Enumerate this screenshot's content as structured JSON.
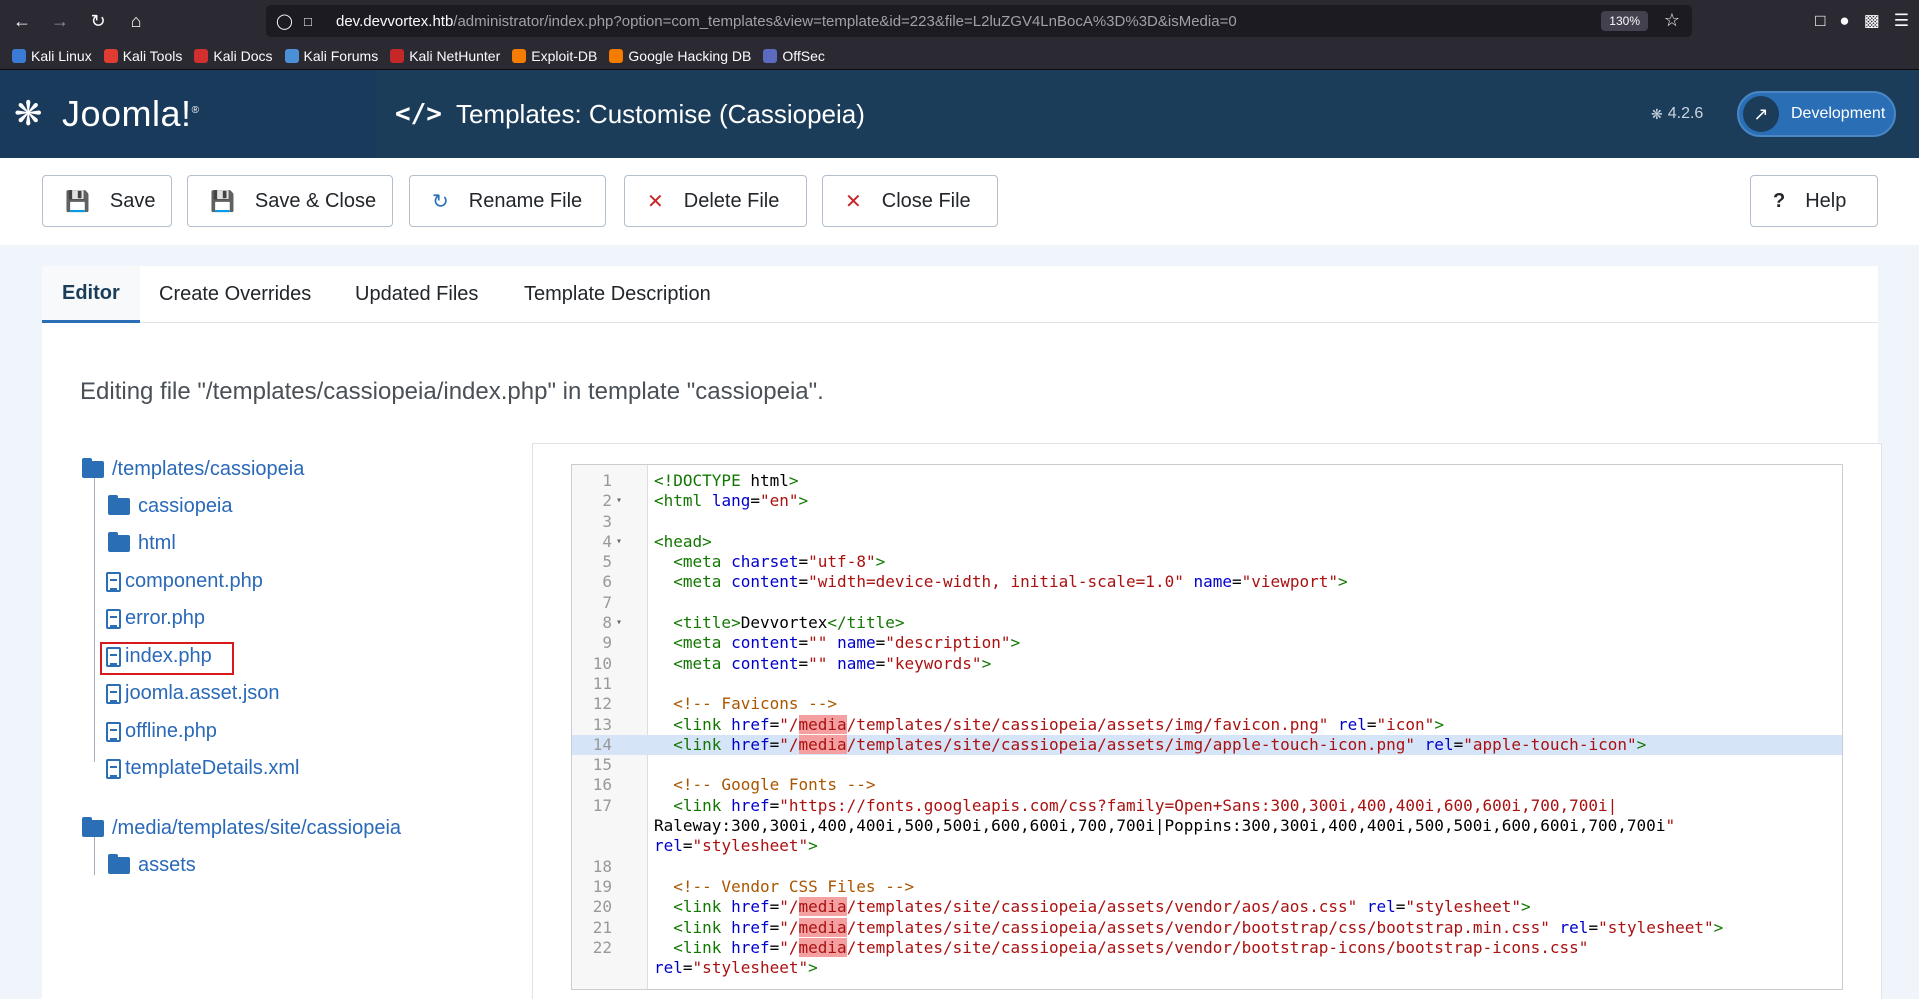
{
  "browser": {
    "url_host": "dev.devvortex.htb",
    "url_path": "/administrator/index.php?option=com_templates&view=template&id=223&file=L2luZGV4LnBocA%3D%3D&isMedia=0",
    "zoom": "130%",
    "icons": [
      "back-icon",
      "forward-icon",
      "reload-icon",
      "home-icon",
      "shield-icon",
      "lock-icon",
      "star-icon",
      "pocket-icon",
      "account-icon",
      "extensions-icon",
      "menu-icon"
    ]
  },
  "bookmarks": [
    {
      "label": "Kali Linux",
      "color": "#3a7bd5"
    },
    {
      "label": "Kali Tools",
      "color": "#e03c31"
    },
    {
      "label": "Kali Docs",
      "color": "#d32f2f"
    },
    {
      "label": "Kali Forums",
      "color": "#4a90d9"
    },
    {
      "label": "Kali NetHunter",
      "color": "#c62828"
    },
    {
      "label": "Exploit-DB",
      "color": "#f57c00"
    },
    {
      "label": "Google Hacking DB",
      "color": "#f57c00"
    },
    {
      "label": "OffSec",
      "color": "#5c6bc0"
    }
  ],
  "header": {
    "logo_text": "Joomla!",
    "page_title": "Templates: Customise (Cassiopeia)",
    "version": "4.2.6",
    "site_button": "Development"
  },
  "toolbar": {
    "save": "Save",
    "save_close": "Save & Close",
    "rename": "Rename File",
    "delete": "Delete File",
    "close": "Close File",
    "help": "Help"
  },
  "tabs": [
    "Editor",
    "Create Overrides",
    "Updated Files",
    "Template Description"
  ],
  "editing_note": "Editing file \"/templates/cassiopeia/index.php\" in template \"cassiopeia\".",
  "tree": {
    "root1": "/templates/cassiopeia",
    "root1_children": [
      {
        "type": "folder",
        "name": "cassiopeia"
      },
      {
        "type": "folder",
        "name": "html"
      },
      {
        "type": "file",
        "name": "component.php"
      },
      {
        "type": "file",
        "name": "error.php"
      },
      {
        "type": "file",
        "name": "index.php",
        "selected": true
      },
      {
        "type": "file",
        "name": "joomla.asset.json"
      },
      {
        "type": "file",
        "name": "offline.php"
      },
      {
        "type": "file",
        "name": "templateDetails.xml"
      }
    ],
    "root2": "/media/templates/site/cassiopeia",
    "root2_children": [
      {
        "type": "folder",
        "name": "assets"
      }
    ]
  },
  "code": {
    "active_line": 14,
    "lines": [
      {
        "n": "1",
        "fold": false,
        "text": "<!DOCTYPE html>"
      },
      {
        "n": "2",
        "fold": true,
        "text": "<html lang=\"en\">"
      },
      {
        "n": "3",
        "fold": false,
        "text": ""
      },
      {
        "n": "4",
        "fold": true,
        "text": "<head>"
      },
      {
        "n": "5",
        "fold": false,
        "text": "  <meta charset=\"utf-8\">"
      },
      {
        "n": "6",
        "fold": false,
        "text": "  <meta content=\"width=device-width, initial-scale=1.0\" name=\"viewport\">"
      },
      {
        "n": "7",
        "fold": false,
        "text": ""
      },
      {
        "n": "8",
        "fold": true,
        "text": "  <title>Devvortex</title>"
      },
      {
        "n": "9",
        "fold": false,
        "text": "  <meta content=\"\" name=\"description\">"
      },
      {
        "n": "10",
        "fold": false,
        "text": "  <meta content=\"\" name=\"keywords\">"
      },
      {
        "n": "11",
        "fold": false,
        "text": ""
      },
      {
        "n": "12",
        "fold": false,
        "text": "  <!-- Favicons -->"
      },
      {
        "n": "13",
        "fold": false,
        "text": "  <link href=\"/media/templates/site/cassiopeia/assets/img/favicon.png\" rel=\"icon\">"
      },
      {
        "n": "14",
        "fold": false,
        "text": "  <link href=\"/media/templates/site/cassiopeia/assets/img/apple-touch-icon.png\" rel=\"apple-touch-icon\">"
      },
      {
        "n": "15",
        "fold": false,
        "text": ""
      },
      {
        "n": "16",
        "fold": false,
        "text": "  <!-- Google Fonts -->"
      },
      {
        "n": "17",
        "fold": false,
        "text": "  <link href=\"https://fonts.googleapis.com/css?family=Open+Sans:300,300i,400,400i,600,600i,700,700i|"
      },
      {
        "n": "",
        "fold": false,
        "text": "Raleway:300,300i,400,400i,500,500i,600,600i,700,700i|Poppins:300,300i,400,400i,500,500i,600,600i,700,700i\""
      },
      {
        "n": "",
        "fold": false,
        "text": "rel=\"stylesheet\">"
      },
      {
        "n": "18",
        "fold": false,
        "text": ""
      },
      {
        "n": "19",
        "fold": false,
        "text": "  <!-- Vendor CSS Files -->"
      },
      {
        "n": "20",
        "fold": false,
        "text": "  <link href=\"/media/templates/site/cassiopeia/assets/vendor/aos/aos.css\" rel=\"stylesheet\">"
      },
      {
        "n": "21",
        "fold": false,
        "text": "  <link href=\"/media/templates/site/cassiopeia/assets/vendor/bootstrap/css/bootstrap.min.css\" rel=\"stylesheet\">"
      },
      {
        "n": "22",
        "fold": false,
        "text": "  <link href=\"/media/templates/site/cassiopeia/assets/vendor/bootstrap-icons/bootstrap-icons.css\""
      },
      {
        "n": "",
        "fold": false,
        "text": "rel=\"stylesheet\">"
      }
    ]
  },
  "colors": {
    "header_bg": "#1c3d5a",
    "link": "#2a69b8",
    "active_line": "#d6e4f7",
    "highlight_box": "#d7191c"
  }
}
